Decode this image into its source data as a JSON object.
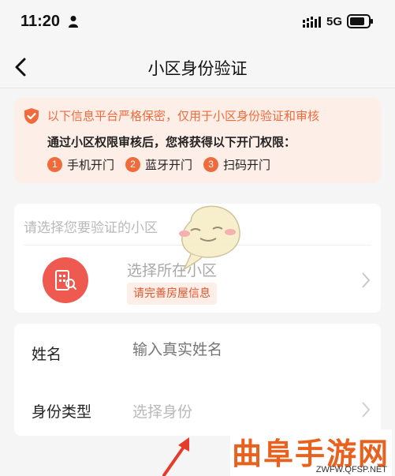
{
  "status_bar": {
    "time": "11:20",
    "network": "5G"
  },
  "nav": {
    "title": "小区身份验证"
  },
  "notice": {
    "privacy_text": "以下信息平台严格保密，仅用于小区身份验证和审核",
    "permission_intro": "通过小区权限审核后，您将获得以下开门权限：",
    "permissions": [
      {
        "num": "1",
        "label": "手机开门"
      },
      {
        "num": "2",
        "label": "蓝牙开门"
      },
      {
        "num": "3",
        "label": "扫码开门"
      }
    ]
  },
  "community_card": {
    "prompt": "请选择您要验证的小区",
    "select_label": "选择所在小区",
    "complete_info_badge": "请完善房屋信息"
  },
  "form": {
    "name_label": "姓名",
    "name_placeholder": "输入真实姓名",
    "identity_label": "身份类型",
    "identity_placeholder": "选择身份"
  },
  "watermark": {
    "text": "曲阜手游网",
    "url": "ZWFW.QFSP.NET"
  },
  "colors": {
    "accent": "#f06b3b",
    "notice_bg": "#fdeee7",
    "avatar_red": "#ef5a50"
  },
  "icons": [
    "person-icon",
    "signal-icon",
    "battery-icon",
    "back-icon",
    "shield-icon",
    "building-icon",
    "chevron-right-icon"
  ]
}
